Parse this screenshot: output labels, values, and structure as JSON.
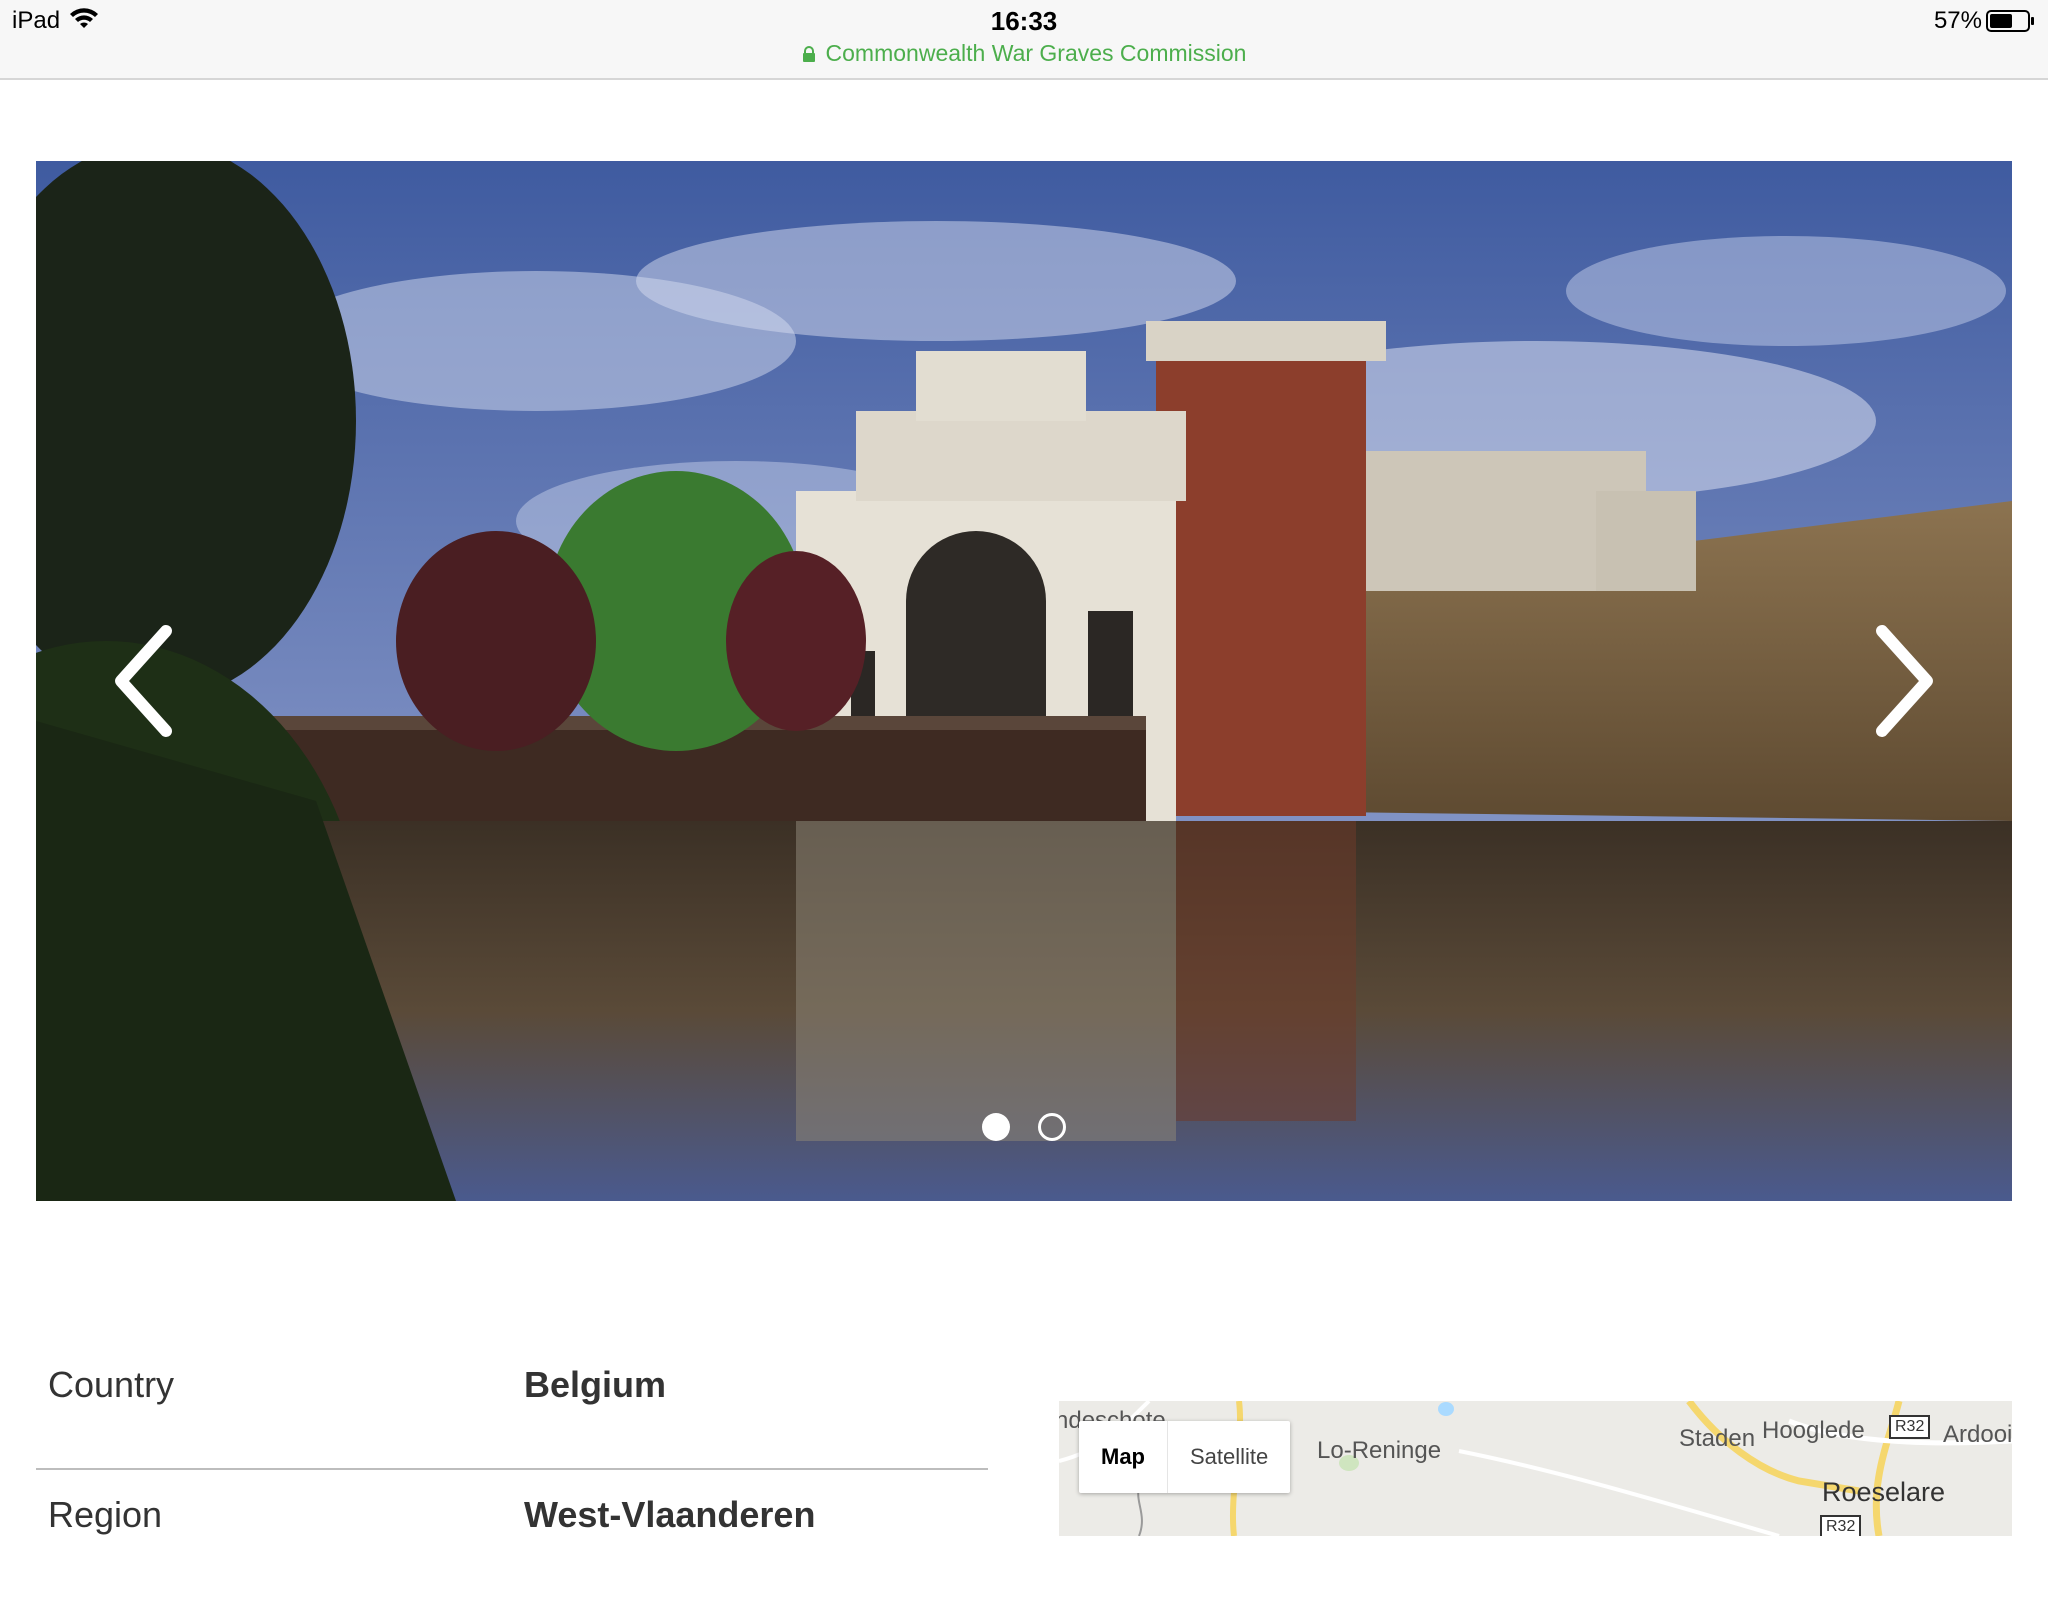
{
  "status": {
    "device": "iPad",
    "time": "16:33",
    "battery": "57%"
  },
  "address": {
    "site": "Commonwealth War Graves Commission"
  },
  "carousel": {
    "prev_icon": "chevron-left-icon",
    "next_icon": "chevron-right-icon",
    "slides": 2,
    "active_slide": 1
  },
  "details": [
    {
      "label": "Country",
      "value": "Belgium"
    },
    {
      "label": "Region",
      "value": "West-Vlaanderen"
    }
  ],
  "map": {
    "toggle": {
      "map_label": "Map",
      "satellite_label": "Satellite",
      "selected": "Map"
    },
    "places": {
      "partial_left": "ndeschote",
      "lo_reninge": "Lo-Reninge",
      "staden": "Staden",
      "hooglede": "Hooglede",
      "ardooie": "Ardooi",
      "roeselare": "Roeselare"
    },
    "roads": {
      "r32_top": "R32",
      "r32_bottom": "R32"
    }
  },
  "colors": {
    "address_green": "#4cae4c",
    "map_bg": "#ecebe7",
    "map_road": "#f5d76e"
  }
}
